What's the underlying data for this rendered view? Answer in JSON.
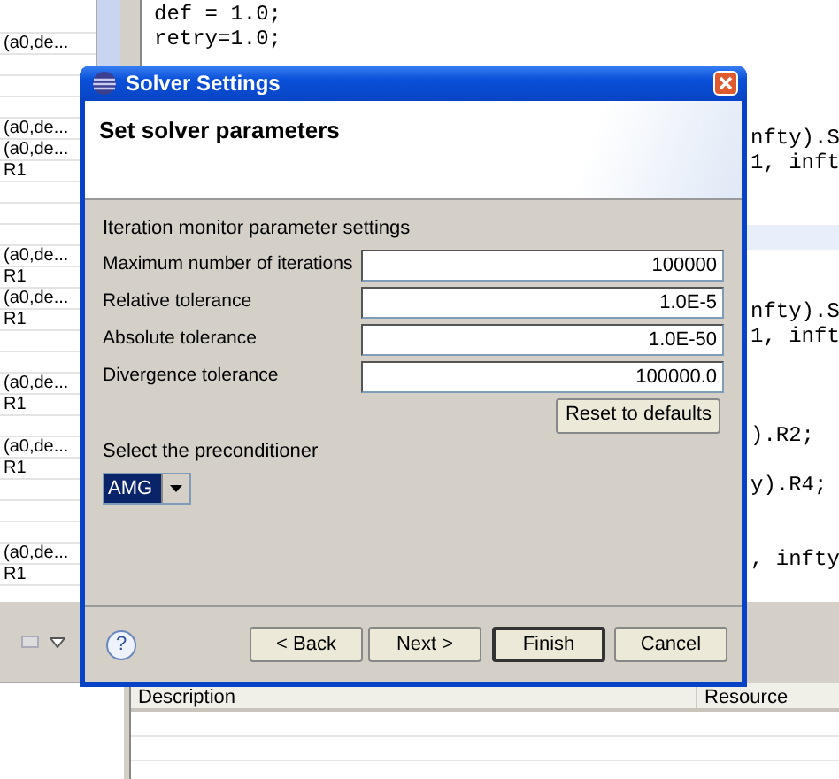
{
  "left_panel": {
    "rows": [
      {
        "kind": "blank"
      },
      {
        "kind": "text",
        "text": "(a0,de..."
      },
      {
        "kind": "blank"
      },
      {
        "kind": "blank"
      },
      {
        "kind": "blank"
      },
      {
        "kind": "text",
        "text": "(a0,de..."
      },
      {
        "kind": "text",
        "text": "(a0,de..."
      },
      {
        "kind": "text",
        "text": "R1"
      },
      {
        "kind": "blank"
      },
      {
        "kind": "blank"
      },
      {
        "kind": "blank"
      },
      {
        "kind": "text",
        "text": "(a0,de..."
      },
      {
        "kind": "text",
        "text": "R1"
      },
      {
        "kind": "text",
        "text": "(a0,de..."
      },
      {
        "kind": "text",
        "text": "R1"
      },
      {
        "kind": "blank"
      },
      {
        "kind": "blank"
      },
      {
        "kind": "text",
        "text": "(a0,de..."
      },
      {
        "kind": "text",
        "text": "R1"
      },
      {
        "kind": "blank"
      },
      {
        "kind": "text",
        "text": "(a0,de..."
      },
      {
        "kind": "text",
        "text": "R1"
      },
      {
        "kind": "blank"
      },
      {
        "kind": "blank"
      },
      {
        "kind": "blank"
      },
      {
        "kind": "text",
        "text": "(a0,de..."
      },
      {
        "kind": "text",
        "text": "R1"
      }
    ]
  },
  "editor": {
    "lines": [
      {
        "kind": "code",
        "text": "def = 1.0;"
      },
      {
        "kind": "code",
        "text": "retry=1.0;"
      },
      {
        "kind": "blank"
      },
      {
        "kind": "blank"
      },
      {
        "kind": "blank"
      },
      {
        "kind": "tail",
        "text": "nfty).S"
      },
      {
        "kind": "tail",
        "text": "1, inft"
      },
      {
        "kind": "blank"
      },
      {
        "kind": "blank"
      },
      {
        "kind": "blank",
        "highlighted": true
      },
      {
        "kind": "blank"
      },
      {
        "kind": "blank"
      },
      {
        "kind": "tail",
        "text": "nfty).S"
      },
      {
        "kind": "tail",
        "text": "1, inft"
      },
      {
        "kind": "blank"
      },
      {
        "kind": "blank"
      },
      {
        "kind": "blank"
      },
      {
        "kind": "tail",
        "text": ").R2;"
      },
      {
        "kind": "blank"
      },
      {
        "kind": "tail",
        "text": "y).R4;"
      },
      {
        "kind": "blank"
      },
      {
        "kind": "blank"
      },
      {
        "kind": "tail",
        "text": ", infty"
      }
    ]
  },
  "dialog": {
    "title": "Solver Settings",
    "heading": "Set solver parameters",
    "group_label": "Iteration monitor parameter settings",
    "fields": [
      {
        "label": "Maximum number of iterations",
        "value": "100000"
      },
      {
        "label": "Relative tolerance",
        "value": "1.0E-5"
      },
      {
        "label": "Absolute tolerance",
        "value": "1.0E-50"
      },
      {
        "label": "Divergence tolerance",
        "value": "100000.0"
      }
    ],
    "reset_button": "Reset to defaults",
    "preconditioner": {
      "label": "Select the preconditioner",
      "value": "AMG",
      "focused": true
    },
    "help": "?",
    "buttons": [
      {
        "label": "< Back",
        "default": false
      },
      {
        "label": "Next >",
        "default": false
      },
      {
        "label": "Finish",
        "default": true
      },
      {
        "label": "Cancel",
        "default": false
      }
    ]
  },
  "problems_view": {
    "columns": [
      "Description",
      "Resource"
    ]
  }
}
